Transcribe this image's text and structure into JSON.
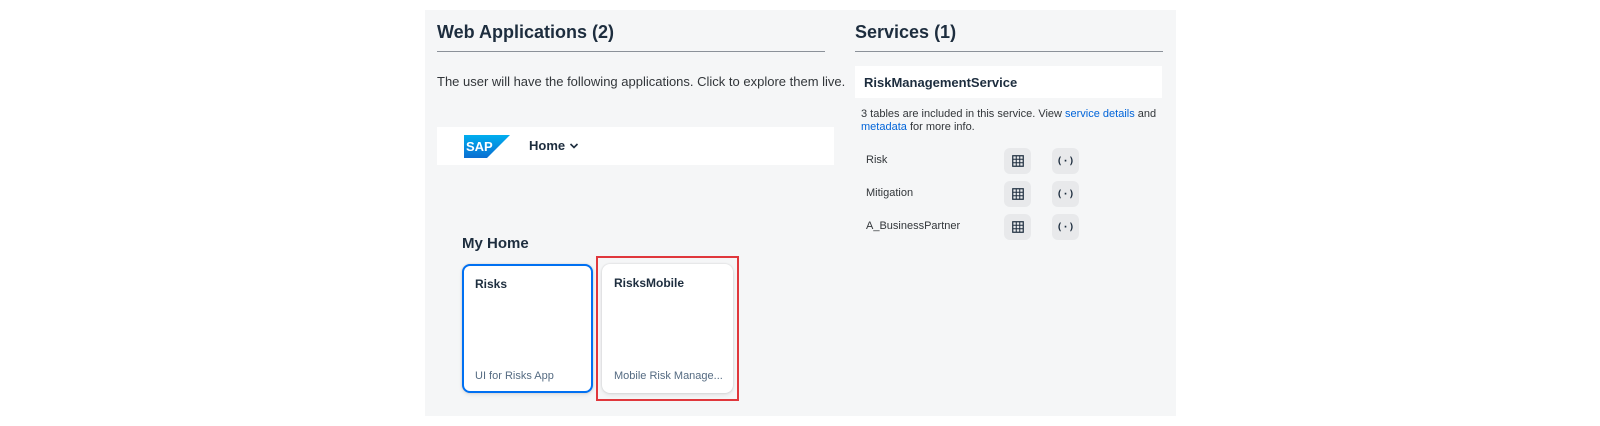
{
  "web_apps": {
    "title": "Web Applications (2)",
    "intro": "The user will have the following applications. Click to explore them live.",
    "shellbar": {
      "logo": "SAP",
      "home_label": "Home"
    },
    "my_home_title": "My Home",
    "tiles": [
      {
        "title": "Risks",
        "subtitle": "UI for Risks App"
      },
      {
        "title": "RisksMobile",
        "subtitle": "Mobile Risk Manage..."
      }
    ]
  },
  "services": {
    "title": "Services (1)",
    "service_name": "RiskManagementService",
    "desc_prefix": "3 tables are included in this service. View",
    "service_details_link": "service details",
    "desc_and": "and",
    "metadata_link": "metadata",
    "desc_suffix": "for more info.",
    "entities": [
      {
        "name": "Risk"
      },
      {
        "name": "Mitigation"
      },
      {
        "name": "A_BusinessPartner"
      }
    ]
  },
  "icons": {
    "logo": "sap-logo",
    "home_dropdown": "chevron-down-icon",
    "table": "table-icon",
    "metadata": "code-braces-icon"
  },
  "colors": {
    "accent": "#0070f2",
    "link": "#0064d9",
    "highlight": "#e0373c",
    "panel_bg": "#f5f6f7",
    "sap_blue": "#0a6ed1"
  },
  "selected_tile_index": 0
}
